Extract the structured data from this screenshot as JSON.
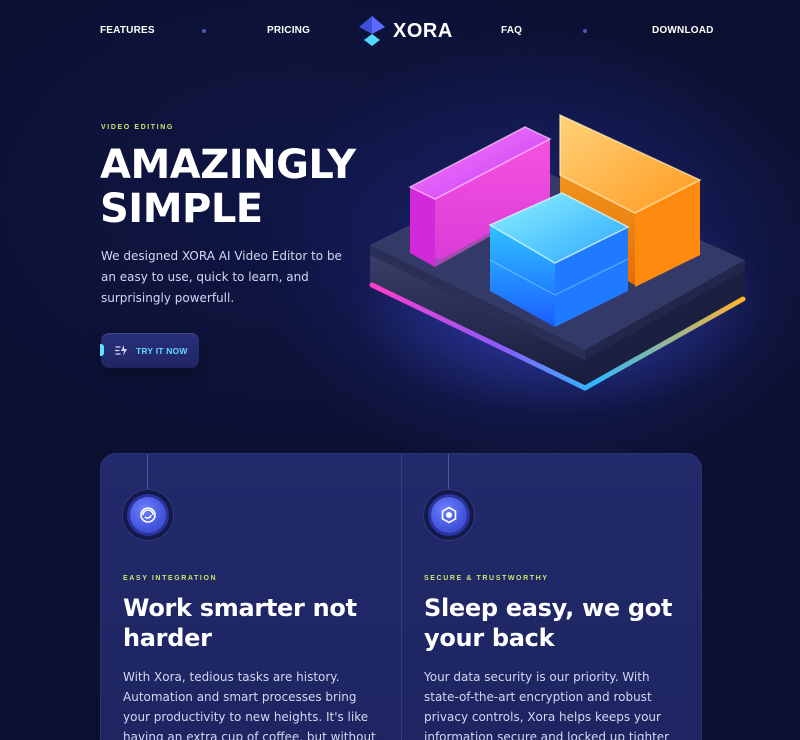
{
  "nav": {
    "left": [
      "FEATURES",
      "PRICING"
    ],
    "logo_text": "XORA",
    "right": [
      "FAQ",
      "DOWNLOAD"
    ]
  },
  "hero": {
    "eyebrow": "VIDEO EDITING",
    "title_line1": "AMAZINGLY",
    "title_line2": "SIMPLE",
    "description": "We designed XORA AI Video Editor to be an easy to use, quick to learn, and surprisingly powerfull.",
    "cta_label": "TRY IT NOW",
    "cta_icon": "zap-icon"
  },
  "features": [
    {
      "icon": "spiral-icon",
      "eyebrow": "EASY INTEGRATION",
      "title": "Work smarter not harder",
      "body": "With Xora, tedious tasks are history. Automation and smart processes bring your productivity to new heights. It's like having an extra cup of coffee, but without the jitters."
    },
    {
      "icon": "shield-icon",
      "eyebrow": "SECURE & TRUSTWORTHY",
      "title": "Sleep easy, we got your back",
      "body": "Your data security is our priority. With state-of-the-art encryption and robust privacy controls, Xora helps keeps your information secure and locked up tighter than Fort Knox."
    }
  ],
  "colors": {
    "background": "#0b1030",
    "accent_lime": "#c8e86a",
    "accent_cyan": "#60d9ff",
    "card_bg": "#222a6b"
  }
}
